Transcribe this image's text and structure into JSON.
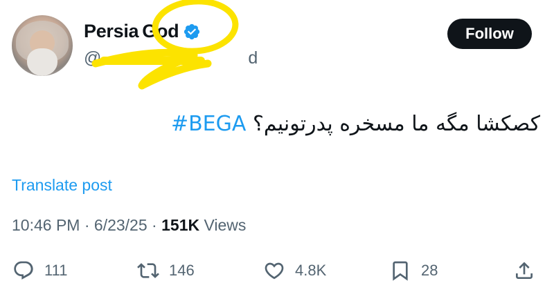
{
  "author": {
    "name_part1": "Persia",
    "name_part2": "God",
    "handle_prefix": "@",
    "handle_visible_end": "d",
    "verified_color": "#1d9bf0"
  },
  "follow_button": {
    "label": "Follow"
  },
  "post": {
    "text": "کصکشا مگه ما مسخره پدرتونیم؟ ",
    "hashtag": "#BEGA"
  },
  "translate_label": "Translate post",
  "meta": {
    "time": "10:46 PM",
    "sep1": " · ",
    "date": "6/23/25",
    "sep2": " · ",
    "views_count": "151K",
    "views_label": " Views"
  },
  "actions": {
    "replies": "111",
    "reposts": "146",
    "likes": "4.8K",
    "bookmarks": "28"
  },
  "colors": {
    "accent": "#1d9bf0",
    "highlight_scribble": "#fce300",
    "secondary_text": "#536471"
  }
}
